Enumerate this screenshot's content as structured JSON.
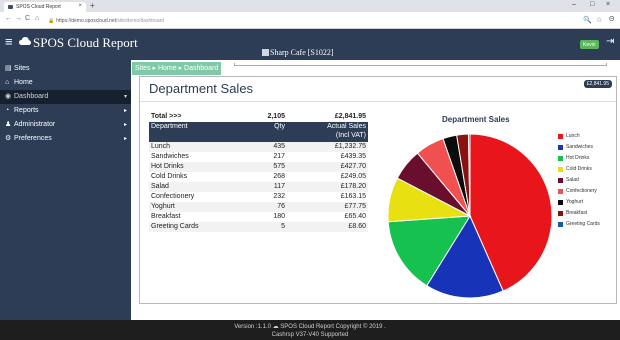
{
  "browser": {
    "tab_title": "SPOS Cloud Report",
    "tab_close": "×",
    "new_tab": "+",
    "url_domain": "https://demo.sposcloud.net",
    "url_path": "/site/demo/dashboard",
    "win_min": "–",
    "win_max": "□",
    "win_close": "×",
    "back_glyph": "←",
    "forward_glyph": "→",
    "reload_glyph": "C",
    "home_glyph": "⌂",
    "lock_glyph": "🔒",
    "zoom_glyph": "🔍",
    "star_glyph": "☆",
    "profile_glyph": "Θ"
  },
  "header": {
    "menu_glyph": "≡",
    "title": "SPOS Cloud Report",
    "site_name": "Sharp Cafe [S1022]",
    "user_button": "Kevin",
    "logout_glyph": "⇥"
  },
  "sidebar": {
    "items": [
      {
        "label": "Sites",
        "icon": "▤"
      },
      {
        "label": "Home",
        "icon": "⌂"
      },
      {
        "label": "Dashboard",
        "icon": "◉",
        "arrow": "▾"
      },
      {
        "label": "Reports",
        "icon": "◔",
        "arrow": "▸"
      },
      {
        "label": "Administrator",
        "icon": "♟",
        "arrow": "▸"
      },
      {
        "label": "Preferences",
        "icon": "⚙",
        "arrow": "▸"
      }
    ]
  },
  "breadcrumb": {
    "text": "Sites ▸ Home ▸ Dashboard"
  },
  "panel": {
    "title": "Department Sales",
    "badge": "£2,841.95"
  },
  "table": {
    "total": {
      "label": "Total >>>",
      "qty": "2,105",
      "amount": "£2,841.95"
    },
    "headers": {
      "department": "Department",
      "qty": "Qty",
      "sales_l1": "Actual Sales",
      "sales_l2": "(Incl VAT)"
    },
    "rows": [
      {
        "department": "Lunch",
        "qty": "435",
        "amount": "£1,232.75"
      },
      {
        "department": "Sandwiches",
        "qty": "217",
        "amount": "£439.35"
      },
      {
        "department": "Hot Drinks",
        "qty": "575",
        "amount": "£427.70"
      },
      {
        "department": "Cold Drinks",
        "qty": "268",
        "amount": "£249.05"
      },
      {
        "department": "Salad",
        "qty": "117",
        "amount": "£178.20"
      },
      {
        "department": "Confectionery",
        "qty": "232",
        "amount": "£163.15"
      },
      {
        "department": "Yoghurt",
        "qty": "76",
        "amount": "£77.75"
      },
      {
        "department": "Breakfast",
        "qty": "180",
        "amount": "£65.40"
      },
      {
        "department": "Greeting Cards",
        "qty": "5",
        "amount": "£8.60"
      }
    ]
  },
  "chart_data": {
    "type": "pie",
    "title": "Department Sales",
    "legend_position": "right",
    "categories": [
      "Lunch",
      "Sandwiches",
      "Hot Drinks",
      "Cold Drinks",
      "Salad",
      "Confectionery",
      "Yoghurt",
      "Breakfast",
      "Greeting Cards"
    ],
    "values": [
      1232.75,
      439.35,
      427.7,
      249.05,
      178.2,
      163.15,
      77.75,
      65.4,
      8.6
    ],
    "colors": [
      "#e8151a",
      "#1733b8",
      "#16c150",
      "#e8e010",
      "#6a0e2e",
      "#f05050",
      "#0c0c0c",
      "#8b1010",
      "#1a5d9e"
    ]
  },
  "footer": {
    "line1": "Version :1.1.0    ☁ SPOS Cloud Report    Copyright © 2019 .",
    "line2": "Cashrsp V37-V40 Supported"
  }
}
